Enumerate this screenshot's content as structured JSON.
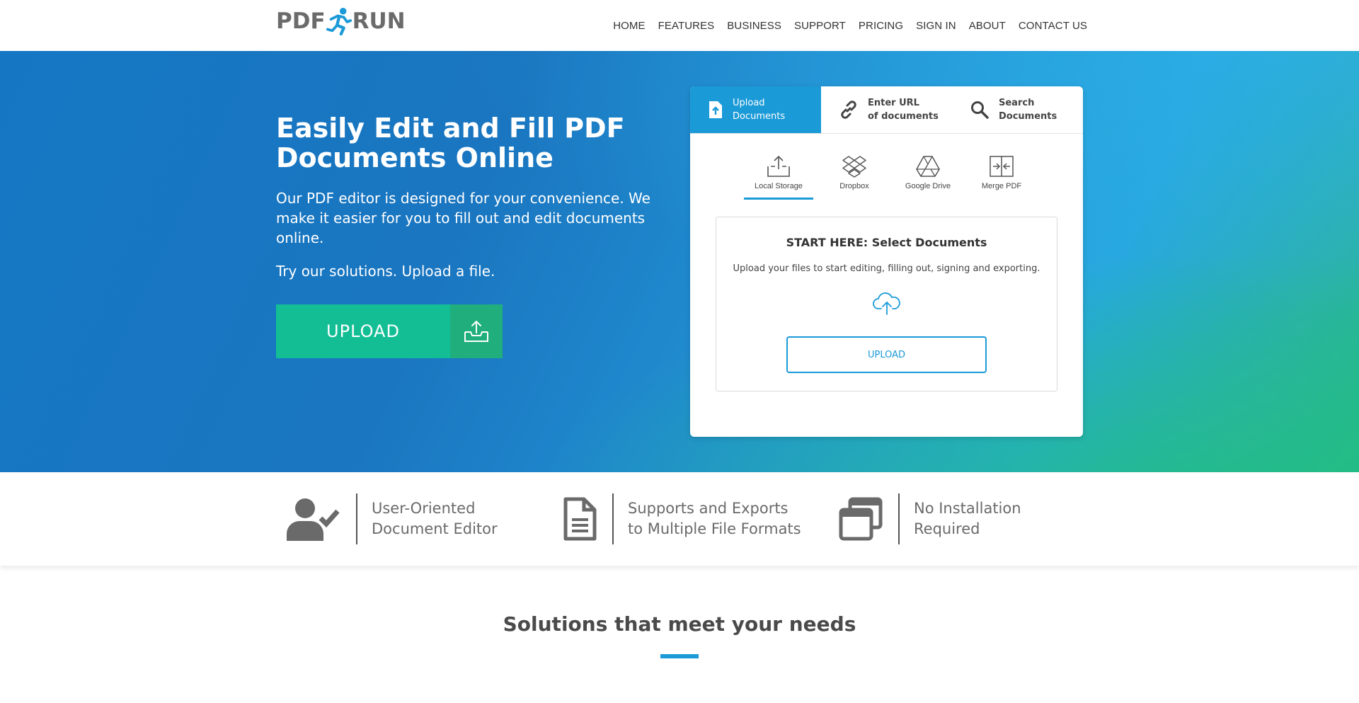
{
  "header": {
    "logo_left": "PDF",
    "logo_right": "RUN",
    "nav": [
      "HOME",
      "FEATURES",
      "BUSINESS",
      "SUPPORT",
      "PRICING",
      "SIGN IN",
      "ABOUT",
      "CONTACT US"
    ]
  },
  "hero": {
    "title": "Easily Edit and Fill PDF Documents Online",
    "description": "Our PDF editor is designed for your convenience. We make it easier for you to fill out and edit documents online.",
    "try_text": "Try our solutions. Upload a file.",
    "upload_label": "UPLOAD"
  },
  "card": {
    "tabs": [
      {
        "line1": "Upload",
        "line2": "Documents",
        "icon": "file-upload-icon"
      },
      {
        "line1": "Enter URL",
        "line2": "of documents",
        "icon": "link-icon"
      },
      {
        "line1": "Search",
        "line2": "Documents",
        "icon": "search-icon"
      }
    ],
    "sources": [
      {
        "label": "Local Storage",
        "icon": "local-storage-icon"
      },
      {
        "label": "Dropbox",
        "icon": "dropbox-icon"
      },
      {
        "label": "Google Drive",
        "icon": "google-drive-icon"
      },
      {
        "label": "Merge PDF",
        "icon": "merge-pdf-icon"
      }
    ],
    "select_title": "START HERE: Select Documents",
    "select_subtitle": "Upload your files to start editing, filling out, signing and exporting.",
    "upload_label": "UPLOAD"
  },
  "features": [
    {
      "line1": "User-Oriented",
      "line2": "Document Editor",
      "icon": "user-check-icon"
    },
    {
      "line1": "Supports and Exports",
      "line2": "to Multiple File Formats",
      "icon": "document-icon"
    },
    {
      "line1": "No Installation",
      "line2": "Required",
      "icon": "windows-icon"
    }
  ],
  "solutions": {
    "title": "Solutions that meet your needs"
  },
  "colors": {
    "accent": "#1b9ad8",
    "upload_green": "#14be95",
    "text_gray": "#6a6a6a"
  }
}
